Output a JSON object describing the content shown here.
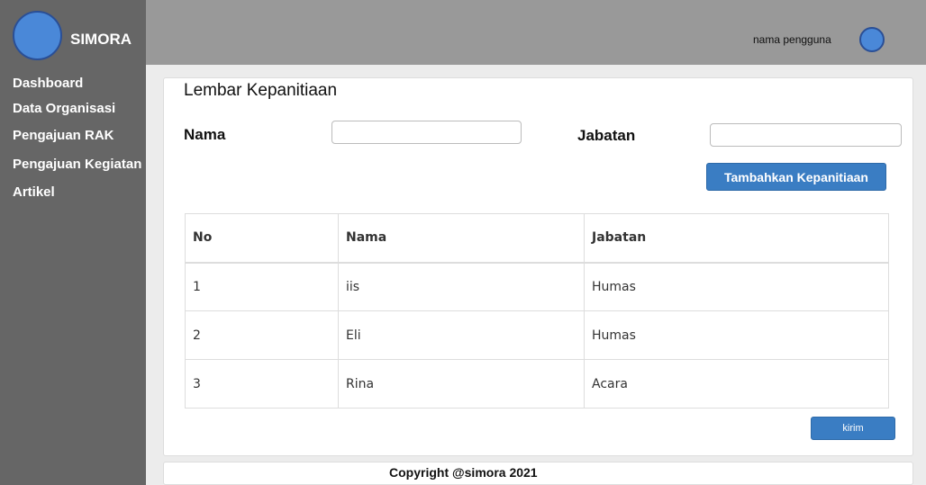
{
  "brand": {
    "name": "SIMORA"
  },
  "sidebar": {
    "items": [
      {
        "label": "Dashboard"
      },
      {
        "label": "Data Organisasi"
      },
      {
        "label": "Pengajuan RAK"
      },
      {
        "label": "Pengajuan Kegiatan"
      },
      {
        "label": "Artikel"
      }
    ]
  },
  "header": {
    "username": "nama pengguna"
  },
  "form": {
    "title": "Lembar Kepanitiaan",
    "name_label": "Nama",
    "name_value": "",
    "position_label": "Jabatan",
    "position_value": "",
    "add_button": "Tambahkan Kepanitiaan"
  },
  "table": {
    "headers": [
      "No",
      "Nama",
      "Jabatan"
    ],
    "rows": [
      [
        "1",
        "iis",
        "Humas"
      ],
      [
        "2",
        "Eli",
        "Humas"
      ],
      [
        "3",
        "Rina",
        "Acara"
      ]
    ]
  },
  "submit_button": "kirim",
  "footer": {
    "copyright": "Copyright @simora 2021"
  },
  "colors": {
    "accent": "#3a7dc3",
    "sidebar": "#666666",
    "topbar": "#999999",
    "avatar": "#4a88d8"
  }
}
